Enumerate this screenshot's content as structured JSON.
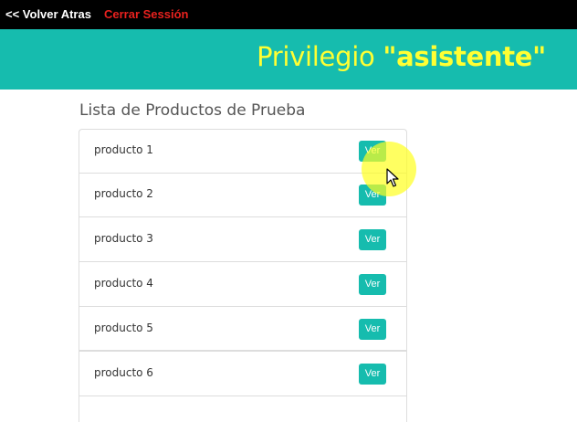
{
  "topbar": {
    "back_label": "<< Volver Atras",
    "logout_label": "Cerrar Sessión"
  },
  "banner": {
    "prefix": "Privilegio",
    "role": "\"asistente\""
  },
  "list": {
    "heading": "Lista de Productos de Prueba",
    "items": [
      {
        "name": "producto 1",
        "button": "Ver"
      },
      {
        "name": "producto 2",
        "button": "Ver"
      },
      {
        "name": "producto 3",
        "button": "Ver"
      },
      {
        "name": "producto 4",
        "button": "Ver"
      },
      {
        "name": "producto 5",
        "button": "Ver"
      },
      {
        "name": "producto 6",
        "button": "Ver"
      }
    ]
  },
  "colors": {
    "accent": "#16bcae",
    "banner_text": "#ffff33",
    "logout": "#e8211e",
    "topbar": "#000000"
  },
  "icons": {
    "cursor": "mouse-pointer-icon"
  }
}
